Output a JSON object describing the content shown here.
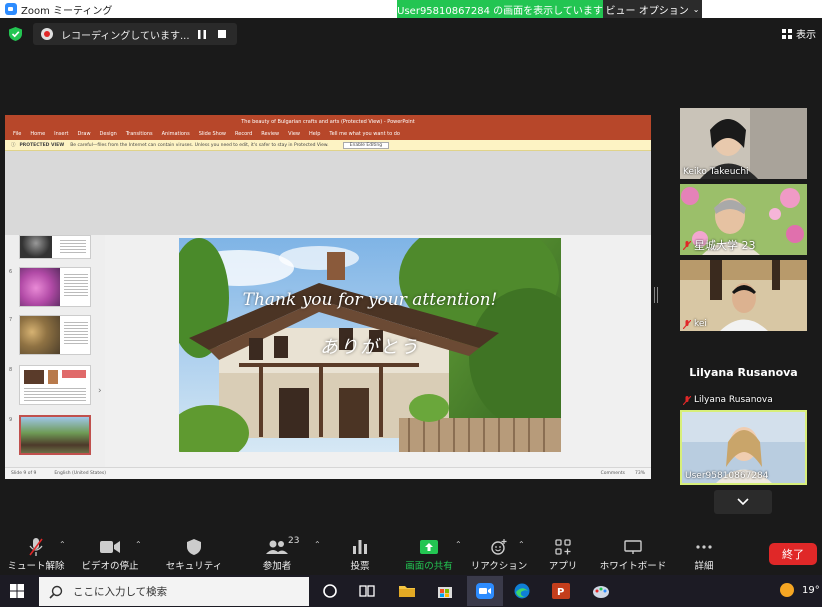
{
  "window": {
    "app_title": "Zoom ミーティング",
    "share_banner": "User95810867284 の画面を表示しています",
    "view_options": "ビュー オプション"
  },
  "recording": {
    "status": "レコーディングしています..."
  },
  "view_toggle": "表示",
  "shared": {
    "ppt_title": "The beauty of Bulgarian crafts and arts (Protected View) - PowerPoint",
    "ribbon_tabs": [
      "File",
      "Home",
      "Insert",
      "Draw",
      "Design",
      "Transitions",
      "Animations",
      "Slide Show",
      "Record",
      "Review",
      "View",
      "Help",
      "Tell me what you want to do"
    ],
    "protected_label": "PROTECTED VIEW",
    "protected_msg": "Be careful—files from the Internet can contain viruses. Unless you need to edit, it's safer to stay in Protected View.",
    "enable_editing": "Enable Editing",
    "thumbnails": [
      {
        "num": "",
        "kind": "craft"
      },
      {
        "num": "6",
        "kind": "flowers"
      },
      {
        "num": "7",
        "kind": "coins"
      },
      {
        "num": "8",
        "kind": "docs"
      },
      {
        "num": "9",
        "kind": "house"
      }
    ],
    "slide_text_1": "Thank you for your attention!",
    "slide_text_2": "ありがとう",
    "status_left": "Slide 9 of 9",
    "status_lang": "English (United States)",
    "status_comments": "Comments",
    "zoom_level": "73%"
  },
  "participants": [
    {
      "name": "Keiko Takeuchi",
      "muted": false,
      "kind": "video"
    },
    {
      "name": "星城大学 23",
      "muted": true,
      "kind": "video"
    },
    {
      "name": "kei",
      "muted": true,
      "kind": "video"
    },
    {
      "name": "Lilyana Rusanova",
      "center_name": "Lilyana Rusanova",
      "muted": true,
      "kind": "name"
    },
    {
      "name": "User95810867284",
      "muted": false,
      "kind": "video",
      "active": true
    }
  ],
  "toolbar": {
    "unmute": "ミュート解除",
    "stop_video": "ビデオの停止",
    "security": "セキュリティ",
    "participants": "参加者",
    "participants_count": "23",
    "polls": "投票",
    "share": "画面の共有",
    "reactions": "リアクション",
    "apps": "アプリ",
    "whiteboard": "ホワイトボード",
    "more": "詳細",
    "end": "終了"
  },
  "taskbar": {
    "search_placeholder": "ここに入力して検索",
    "temperature": "19°"
  },
  "colors": {
    "zoom_green": "#23c552",
    "end_red": "#e02828",
    "ppt_red": "#b7472a",
    "speaker_border": "#d8ef7a"
  }
}
